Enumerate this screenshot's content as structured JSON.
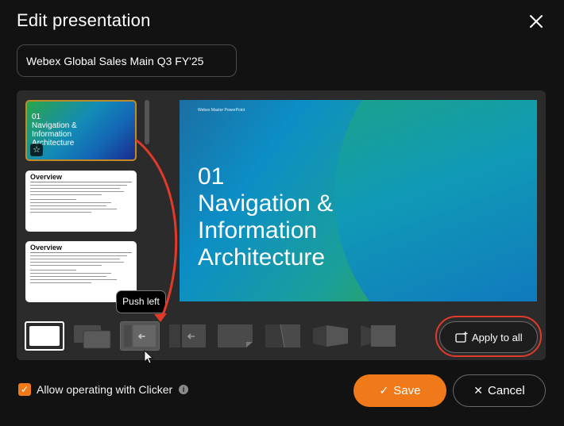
{
  "dialog": {
    "title": "Edit presentation",
    "close_icon": "close-icon"
  },
  "presentation_name": {
    "value": "Webex Global Sales Main Q3 FY'25"
  },
  "slides": [
    {
      "title": "01\nNavigation &\nInformation\nArchitecture",
      "selected": true
    },
    {
      "title": "Overview"
    },
    {
      "title": "Overview"
    }
  ],
  "preview": {
    "tag": "Webex Master PowerPoint",
    "headline": "01\nNavigation &\nInformation\nArchitecture"
  },
  "tooltip": "Push left",
  "transitions": [
    "none",
    "cover",
    "push-left",
    "push-left-alt",
    "peel",
    "page-turn",
    "flip",
    "reveal"
  ],
  "apply_all": {
    "label": "Apply to all"
  },
  "clicker": {
    "label": "Allow operating with Clicker",
    "checked": true
  },
  "buttons": {
    "save": "Save",
    "cancel": "Cancel"
  },
  "colors": {
    "accent": "#f07a1a",
    "highlight": "#e23a2a",
    "selected_border": "#c08a2a"
  }
}
